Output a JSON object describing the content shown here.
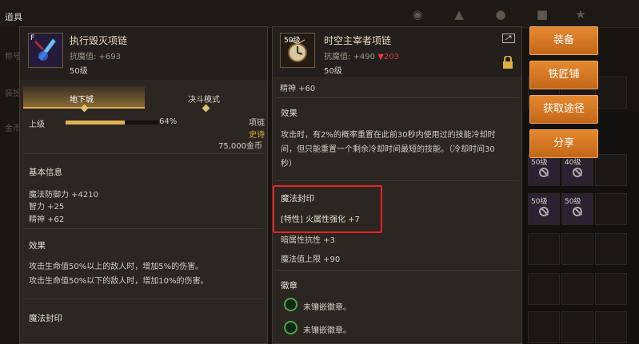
{
  "topbar": {
    "title": "道具"
  },
  "sidebar_labels": [
    "称号",
    "装扮",
    "金币"
  ],
  "left_panel": {
    "item_name": "执行毁灭项链",
    "rank_badge": "F",
    "magic_resist": "抗魔值: +693",
    "level": "50级",
    "tabs": [
      "地下城",
      "决斗模式"
    ],
    "upgrade_label": "上级",
    "upgrade_percent": "64%",
    "upgrade_fraction": 0.64,
    "slot_type": "项链",
    "rarity": "史诗",
    "price": "75,000金币",
    "basic_info_title": "基本信息",
    "basic_stats": [
      "魔法防御力 +4210",
      "智力 +25",
      "精神 +62"
    ],
    "effect_title": "效果",
    "effect_lines": [
      "攻击生命值50%以上的敌人时，增加5%的伤害。",
      "攻击生命值50%以下的敌人时，增加10%的伤害。"
    ],
    "seal_title": "魔法封印"
  },
  "right_panel": {
    "level_badge": "50级",
    "item_name": "时空主宰者项链",
    "magic_resist": "抗魔值: +490",
    "magic_resist_diff": "▼203",
    "level": "50级",
    "spirit": "精神 +60",
    "effect_title": "效果",
    "effect_text": [
      "攻击时，有2%的概率重置在此前30秒内使用过的技能冷却时",
      "间，但只能重置一个剩余冷却时间最短的技能。（冷却时间30",
      "秒）"
    ],
    "seal_title": "魔法封印",
    "seal_trait": "[特性] 火属性强化 +7",
    "seal_line2": "暗属性抗性 +3",
    "seal_line3": "魔法值上限 +90",
    "badge_title": "徽章",
    "badge_slots": [
      "未镶嵌徽章。",
      "未镶嵌徽章。"
    ]
  },
  "buttons": {
    "equip": "装备",
    "blacksmith": "铁匠铺",
    "obtain": "获取途径",
    "share": "分享"
  },
  "inventory_slots": [
    {
      "label": "50级"
    },
    {
      "label": "40级"
    },
    {
      "label": "50级"
    },
    {
      "label": "50级"
    }
  ],
  "colors": {
    "accent": "#d8792a",
    "highlight_border": "#e5231f",
    "rarity": "#e1a93c",
    "decrease": "#e23a3a"
  }
}
